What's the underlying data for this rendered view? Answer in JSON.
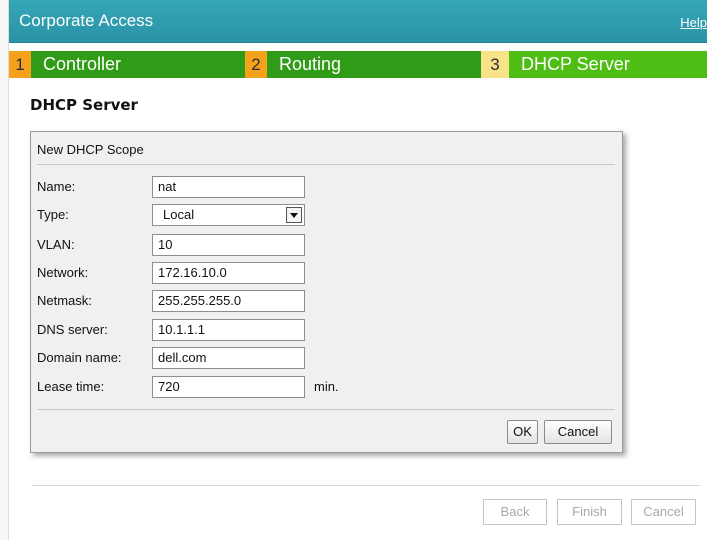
{
  "window": {
    "title": "Corporate Access",
    "help_label": "Help"
  },
  "steps": [
    {
      "number": "1",
      "label": "Controller",
      "state": "completed"
    },
    {
      "number": "2",
      "label": "Routing",
      "state": "completed"
    },
    {
      "number": "3",
      "label": "DHCP Server",
      "state": "active"
    }
  ],
  "section": {
    "title": "DHCP Server"
  },
  "dialog": {
    "title": "New DHCP Scope",
    "fields": {
      "name": {
        "label": "Name:",
        "value": "nat"
      },
      "type": {
        "label": "Type:",
        "value": "Local"
      },
      "vlan": {
        "label": "VLAN:",
        "value": "10"
      },
      "network": {
        "label": "Network:",
        "value": "172.16.10.0"
      },
      "netmask": {
        "label": "Netmask:",
        "value": "255.255.255.0"
      },
      "dns": {
        "label": "DNS server:",
        "value": "10.1.1.1"
      },
      "domain": {
        "label": "Domain name:",
        "value": "dell.com"
      },
      "lease": {
        "label": "Lease time:",
        "value": "720",
        "unit": "min."
      }
    },
    "ok_label": "OK",
    "cancel_label": "Cancel"
  },
  "footer": {
    "back_label": "Back",
    "finish_label": "Finish",
    "cancel_label": "Cancel",
    "enabled": false
  },
  "colors": {
    "titlebar": "#2a93a6",
    "step_completed": "#2f9b16",
    "step_active": "#4fbe14",
    "step_number_completed": "#f6a11c",
    "step_number_active": "#f8e389"
  }
}
